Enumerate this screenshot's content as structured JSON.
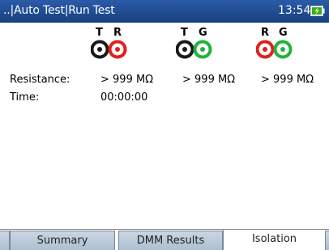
{
  "titlebar": {
    "breadcrumb": "..|Auto Test|Run Test",
    "time": "13:54",
    "battery_icon": "battery-charging-icon"
  },
  "probes": [
    {
      "left": "T",
      "right": "R",
      "left_color": "#1a1a1a",
      "right_color": "#e02020"
    },
    {
      "left": "T",
      "right": "G",
      "left_color": "#1a1a1a",
      "right_color": "#22b33a"
    },
    {
      "left": "R",
      "right": "G",
      "left_color": "#e02020",
      "right_color": "#22b33a"
    }
  ],
  "rows": {
    "resistance": {
      "label": "Resistance:",
      "values": [
        "> 999 MΩ",
        "> 999 MΩ",
        "> 999 MΩ"
      ]
    },
    "time": {
      "label": "Time:",
      "value": "00:00:00"
    }
  },
  "tabs": [
    "Summary",
    "DMM Results",
    "Isolation"
  ],
  "active_tab": "Isolation"
}
